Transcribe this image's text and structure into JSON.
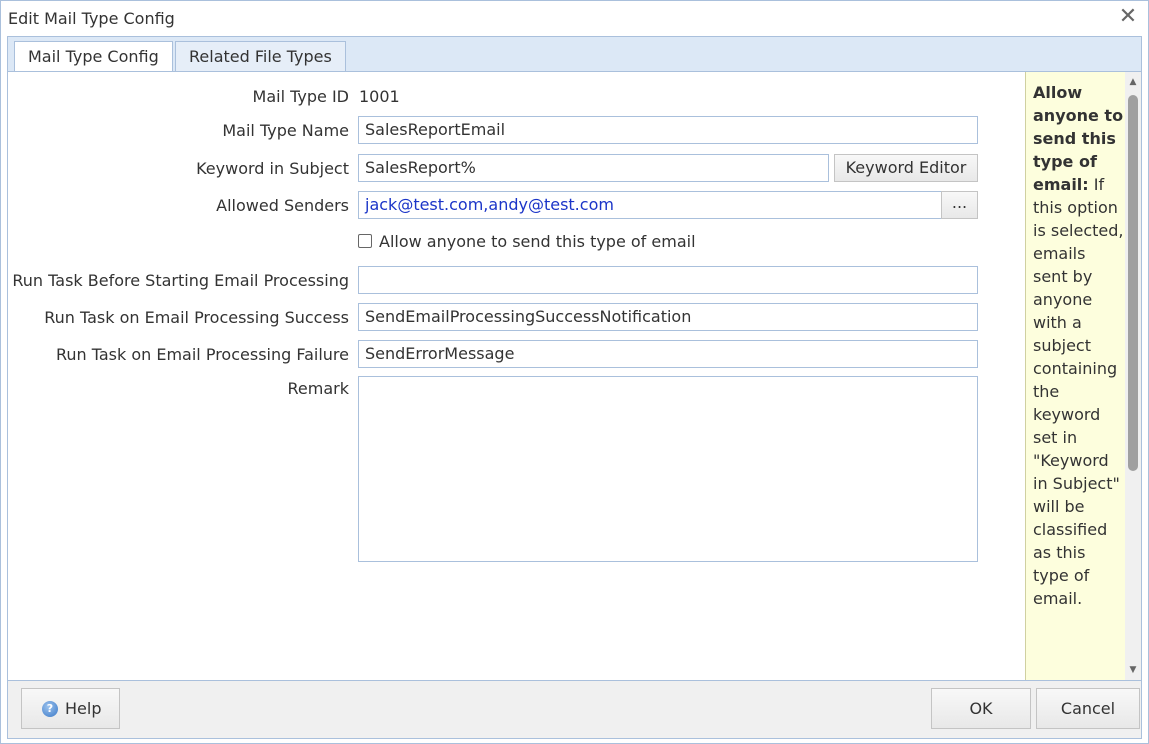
{
  "window": {
    "title": "Edit Mail Type Config",
    "close_glyph": "✕"
  },
  "tabs": [
    {
      "label": "Mail Type Config",
      "active": true
    },
    {
      "label": "Related File Types",
      "active": false
    }
  ],
  "form": {
    "mail_type_id_label": "Mail Type ID",
    "mail_type_id_value": "1001",
    "mail_type_name_label": "Mail Type Name",
    "mail_type_name_value": "SalesReportEmail",
    "keyword_label": "Keyword in Subject",
    "keyword_value": "SalesReport%",
    "keyword_editor_button": "Keyword Editor",
    "allowed_senders_label": "Allowed Senders",
    "allowed_senders_value": "jack@test.com,andy@test.com",
    "allowed_senders_browse": "...",
    "allow_anyone_label": "Allow anyone to send this type of email",
    "allow_anyone_checked": false,
    "run_before_label": "Run Task Before Starting Email Processing",
    "run_before_value": "",
    "run_success_label": "Run Task on Email Processing Success",
    "run_success_value": "SendEmailProcessingSuccessNotification",
    "run_failure_label": "Run Task on Email Processing Failure",
    "run_failure_value": "SendErrorMessage",
    "remark_label": "Remark",
    "remark_value": ""
  },
  "help_panel": {
    "title": "Allow anyone to send this type of email:",
    "body": "If this option is selected, emails sent by anyone with a subject containing the keyword set in \"Keyword in Subject\" will be classified as this type of email."
  },
  "footer": {
    "help_label": "Help",
    "ok_label": "OK",
    "cancel_label": "Cancel"
  },
  "colors": {
    "accent_border": "#aac0dc",
    "help_bg": "#fdfedd",
    "link_blue": "#1b35c8"
  }
}
